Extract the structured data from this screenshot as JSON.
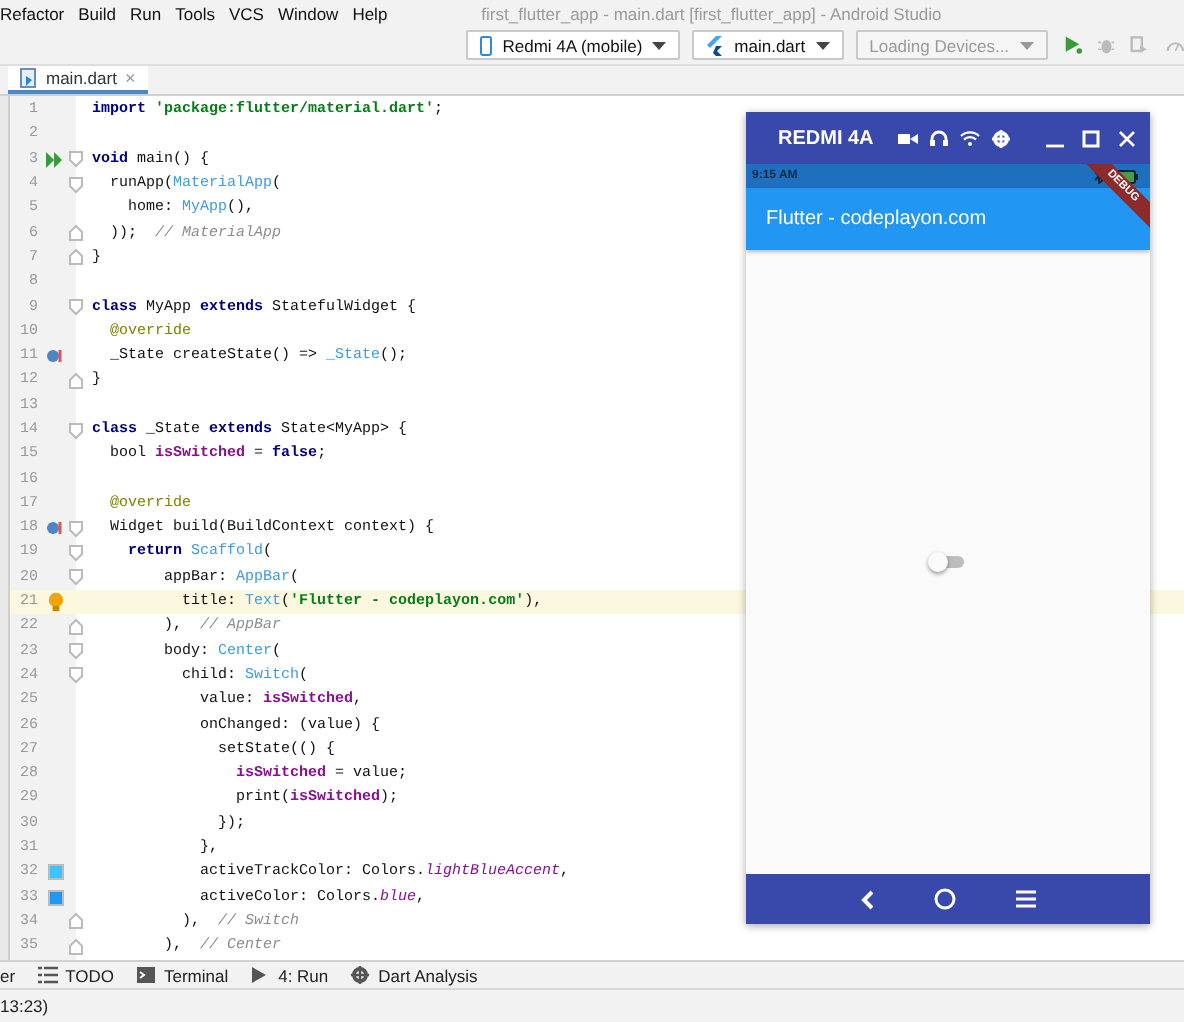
{
  "menu": [
    {
      "label": "Refactor"
    },
    {
      "label": "Build"
    },
    {
      "label": "Run"
    },
    {
      "label": "Tools"
    },
    {
      "label": "VCS"
    },
    {
      "label": "Window"
    },
    {
      "label": "Help"
    }
  ],
  "window": {
    "title": "first_flutter_app - main.dart [first_flutter_app] - Android Studio"
  },
  "toolbar": {
    "device": "Redmi 4A (mobile)",
    "config": "main.dart",
    "device_status": "Loading Devices..."
  },
  "editor_tabs": [
    {
      "label": "main.dart",
      "close": "×",
      "selected": true
    }
  ],
  "code": [
    {
      "number": "1",
      "tokens": [
        {
          "kind": "keyword",
          "text": "import "
        },
        {
          "kind": "string",
          "text": "'package:flutter/material.dart'"
        },
        {
          "kind": "plain",
          "text": ";"
        }
      ]
    },
    {
      "number": "2"
    },
    {
      "number": "3",
      "marker": {
        "kind": "run"
      },
      "fold": {
        "kind": "open"
      },
      "tokens": [
        {
          "kind": "keyword",
          "text": "void "
        },
        {
          "kind": "plain",
          "text": "main() {"
        }
      ]
    },
    {
      "number": "4",
      "fold": {
        "kind": "open"
      },
      "tokens": [
        {
          "kind": "plain",
          "text": "  runApp("
        },
        {
          "kind": "type",
          "text": "MaterialApp"
        },
        {
          "kind": "plain",
          "text": "("
        }
      ]
    },
    {
      "number": "5",
      "tokens": [
        {
          "kind": "plain",
          "text": "    home: "
        },
        {
          "kind": "type",
          "text": "MyApp"
        },
        {
          "kind": "plain",
          "text": "(),"
        }
      ]
    },
    {
      "number": "6",
      "fold": {
        "kind": "close"
      },
      "tokens": [
        {
          "kind": "plain",
          "text": "  ));  "
        },
        {
          "kind": "comment",
          "text": "// MaterialApp"
        }
      ]
    },
    {
      "number": "7",
      "fold": {
        "kind": "close"
      },
      "tokens": [
        {
          "kind": "plain",
          "text": "}"
        }
      ]
    },
    {
      "number": "8"
    },
    {
      "number": "9",
      "fold": {
        "kind": "open"
      },
      "tokens": [
        {
          "kind": "keyword",
          "text": "class "
        },
        {
          "kind": "plain",
          "text": "MyApp "
        },
        {
          "kind": "keyword",
          "text": "extends "
        },
        {
          "kind": "plain",
          "text": "StatefulWidget {"
        }
      ]
    },
    {
      "number": "10",
      "tokens": [
        {
          "kind": "annotation",
          "text": "  @override"
        }
      ]
    },
    {
      "number": "11",
      "marker": {
        "kind": "override"
      },
      "tokens": [
        {
          "kind": "plain",
          "text": "  _State createState() => "
        },
        {
          "kind": "type",
          "text": "_State"
        },
        {
          "kind": "plain",
          "text": "();"
        }
      ]
    },
    {
      "number": "12",
      "fold": {
        "kind": "close"
      },
      "tokens": [
        {
          "kind": "plain",
          "text": "}"
        }
      ]
    },
    {
      "number": "13"
    },
    {
      "number": "14",
      "fold": {
        "kind": "open"
      },
      "tokens": [
        {
          "kind": "keyword",
          "text": "class "
        },
        {
          "kind": "plain",
          "text": "_State "
        },
        {
          "kind": "keyword",
          "text": "extends "
        },
        {
          "kind": "plain",
          "text": "State<MyApp> {"
        }
      ]
    },
    {
      "number": "15",
      "tokens": [
        {
          "kind": "plain",
          "text": "  bool "
        },
        {
          "kind": "field",
          "text": "isSwitched"
        },
        {
          "kind": "plain",
          "text": " = "
        },
        {
          "kind": "keyword",
          "text": "false"
        },
        {
          "kind": "plain",
          "text": ";"
        }
      ]
    },
    {
      "number": "16"
    },
    {
      "number": "17",
      "tokens": [
        {
          "kind": "annotation",
          "text": "  @override"
        }
      ]
    },
    {
      "number": "18",
      "marker": {
        "kind": "override"
      },
      "fold": {
        "kind": "open"
      },
      "tokens": [
        {
          "kind": "plain",
          "text": "  Widget build(BuildContext context) {"
        }
      ]
    },
    {
      "number": "19",
      "fold": {
        "kind": "open"
      },
      "tokens": [
        {
          "kind": "keyword",
          "text": "    return "
        },
        {
          "kind": "type",
          "text": "Scaffold"
        },
        {
          "kind": "plain",
          "text": "("
        }
      ]
    },
    {
      "number": "20",
      "fold": {
        "kind": "open"
      },
      "tokens": [
        {
          "kind": "plain",
          "text": "        appBar: "
        },
        {
          "kind": "type",
          "text": "AppBar"
        },
        {
          "kind": "plain",
          "text": "("
        }
      ]
    },
    {
      "number": "21",
      "marker": {
        "kind": "bulb"
      },
      "current": true,
      "tokens": [
        {
          "kind": "plain",
          "text": "          title: "
        },
        {
          "kind": "type",
          "text": "Text"
        },
        {
          "kind": "plain",
          "text": "("
        },
        {
          "kind": "string",
          "text": "'Flutter - codeplayon.com'"
        },
        {
          "kind": "plain",
          "text": "),"
        }
      ]
    },
    {
      "number": "22",
      "fold": {
        "kind": "close"
      },
      "tokens": [
        {
          "kind": "plain",
          "text": "        ),  "
        },
        {
          "kind": "comment",
          "text": "// AppBar"
        }
      ]
    },
    {
      "number": "23",
      "fold": {
        "kind": "open"
      },
      "tokens": [
        {
          "kind": "plain",
          "text": "        body: "
        },
        {
          "kind": "type",
          "text": "Center"
        },
        {
          "kind": "plain",
          "text": "("
        }
      ]
    },
    {
      "number": "24",
      "fold": {
        "kind": "open"
      },
      "tokens": [
        {
          "kind": "plain",
          "text": "          child: "
        },
        {
          "kind": "type",
          "text": "Switch"
        },
        {
          "kind": "plain",
          "text": "("
        }
      ]
    },
    {
      "number": "25",
      "tokens": [
        {
          "kind": "plain",
          "text": "            value: "
        },
        {
          "kind": "field",
          "text": "isSwitched"
        },
        {
          "kind": "plain",
          "text": ","
        }
      ]
    },
    {
      "number": "26",
      "tokens": [
        {
          "kind": "plain",
          "text": "            onChanged: (value) {"
        }
      ]
    },
    {
      "number": "27",
      "tokens": [
        {
          "kind": "plain",
          "text": "              setState(() {"
        }
      ]
    },
    {
      "number": "28",
      "tokens": [
        {
          "kind": "field",
          "text": "                isSwitched"
        },
        {
          "kind": "plain",
          "text": " = value;"
        }
      ]
    },
    {
      "number": "29",
      "tokens": [
        {
          "kind": "plain",
          "text": "                print("
        },
        {
          "kind": "field",
          "text": "isSwitched"
        },
        {
          "kind": "plain",
          "text": ");"
        }
      ]
    },
    {
      "number": "30",
      "tokens": [
        {
          "kind": "plain",
          "text": "              });"
        }
      ]
    },
    {
      "number": "31",
      "tokens": [
        {
          "kind": "plain",
          "text": "            },"
        }
      ]
    },
    {
      "number": "32",
      "marker": {
        "kind": "swatch",
        "color": "#40c4ff"
      },
      "tokens": [
        {
          "kind": "plain",
          "text": "            activeTrackColor: Colors."
        },
        {
          "kind": "static",
          "text": "lightBlueAccent"
        },
        {
          "kind": "plain",
          "text": ","
        }
      ]
    },
    {
      "number": "33",
      "marker": {
        "kind": "swatch",
        "color": "#2196f3"
      },
      "tokens": [
        {
          "kind": "plain",
          "text": "            activeColor: Colors."
        },
        {
          "kind": "static",
          "text": "blue"
        },
        {
          "kind": "plain",
          "text": ","
        }
      ]
    },
    {
      "number": "34",
      "fold": {
        "kind": "close"
      },
      "tokens": [
        {
          "kind": "plain",
          "text": "          ),  "
        },
        {
          "kind": "comment",
          "text": "// Switch"
        }
      ]
    },
    {
      "number": "35",
      "fold": {
        "kind": "close"
      },
      "tokens": [
        {
          "kind": "plain",
          "text": "        ),  "
        },
        {
          "kind": "comment",
          "text": "// Center"
        }
      ]
    }
  ],
  "emulator": {
    "title": "REDMI 4A",
    "time": "9:15 AM",
    "app_title": "Flutter - codeplayon.com",
    "debug_banner": "DEBUG",
    "switch": {
      "on": false
    }
  },
  "tool_windows": [
    {
      "label": "er"
    },
    {
      "label": "TODO",
      "kind": "list"
    },
    {
      "label": "Terminal",
      "kind": "terminal"
    },
    {
      "label": "4: Run",
      "kind": "run"
    },
    {
      "label": "Dart Analysis",
      "kind": "analysis"
    }
  ],
  "status_bar": {
    "text": "13:23)"
  }
}
